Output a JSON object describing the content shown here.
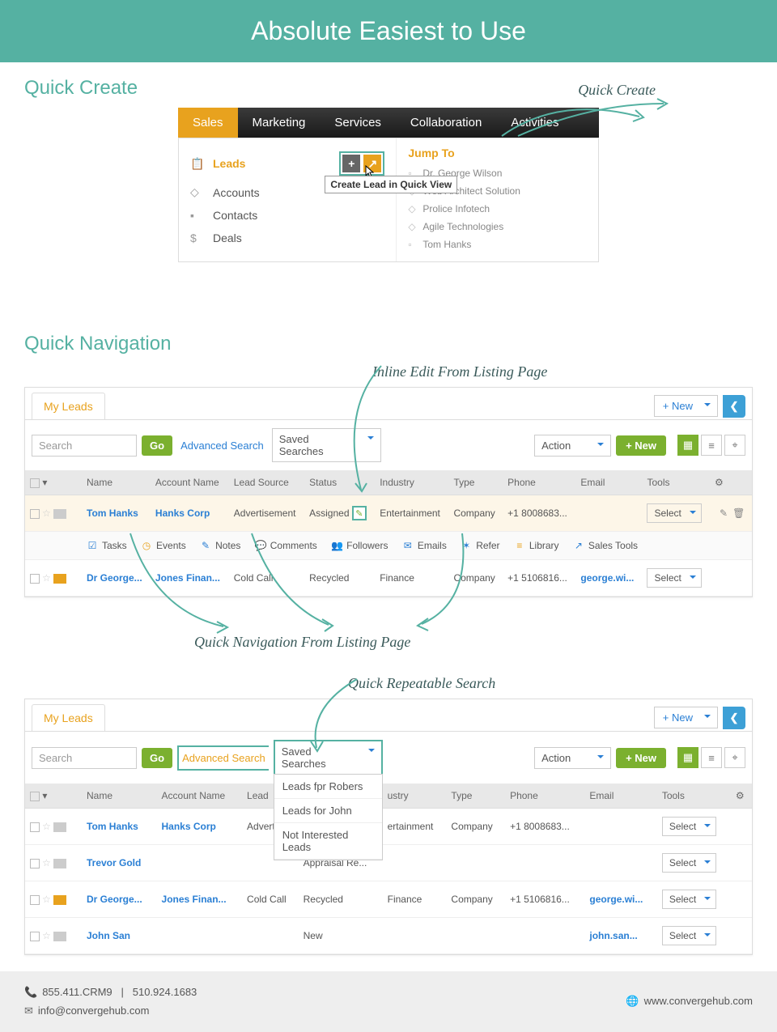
{
  "banner": {
    "title": "Absolute Easiest to Use"
  },
  "sections": {
    "quick_create": "Quick Create",
    "quick_navigation": "Quick Navigation"
  },
  "annotations": {
    "quick_create": "Quick Create",
    "inline_edit": "Inline Edit From Listing Page",
    "quick_nav": "Quick Navigation From Listing Page",
    "quick_search": "Quick Repeatable Search"
  },
  "nav": {
    "tabs": [
      "Sales",
      "Marketing",
      "Services",
      "Collaboration",
      "Activities"
    ],
    "active": "Sales",
    "menu": {
      "leads": "Leads",
      "accounts": "Accounts",
      "contacts": "Contacts",
      "deals": "Deals"
    },
    "tooltip": "Create Lead in Quick View",
    "jump_title": "Jump To",
    "jump": [
      "Dr. George Wilson",
      "Web Architect Solution",
      "Prolice Infotech",
      "Agile Technologies",
      "Tom Hanks"
    ]
  },
  "leads_panel": {
    "tab": "My Leads",
    "new_drop": "+ New",
    "search_ph": "Search",
    "go": "Go",
    "adv": "Advanced Search",
    "saved": "Saved Searches",
    "saved_items": [
      "Leads fpr Robers",
      "Leads for John",
      "Not Interested Leads"
    ],
    "action": "Action",
    "newbtn": "+ New",
    "select": "Select",
    "headers": {
      "name": "Name",
      "account": "Account Name",
      "source": "Lead Source",
      "status": "Status",
      "industry": "Industry",
      "type": "Type",
      "phone": "Phone",
      "email": "Email",
      "tools": "Tools"
    },
    "subtools": {
      "tasks": "Tasks",
      "events": "Events",
      "notes": "Notes",
      "comments": "Comments",
      "followers": "Followers",
      "emails": "Emails",
      "refer": "Refer",
      "library": "Library",
      "salestools": "Sales Tools"
    }
  },
  "rows1": [
    {
      "name": "Tom Hanks",
      "account": "Hanks Corp",
      "source": "Advertisement",
      "status": "Assigned",
      "industry": "Entertainment",
      "type": "Company",
      "phone": "+1 8008683...",
      "email": "",
      "flag": "g",
      "hl": true
    },
    {
      "name": "Dr George...",
      "account": "Jones Finan...",
      "source": "Cold Call",
      "status": "Recycled",
      "industry": "Finance",
      "type": "Company",
      "phone": "+1 5106816...",
      "email": "george.wi...",
      "flag": "o"
    }
  ],
  "rows2": [
    {
      "name": "Tom Hanks",
      "account": "Hanks Corp",
      "source": "Advert",
      "status": "",
      "industry": "ertainment",
      "type": "Company",
      "phone": "+1 8008683...",
      "email": "",
      "flag": "g"
    },
    {
      "name": "Trevor Gold",
      "account": "",
      "source": "",
      "status": "Appraisal Re...",
      "industry": "",
      "type": "",
      "phone": "",
      "email": "",
      "flag": "g"
    },
    {
      "name": "Dr George...",
      "account": "Jones Finan...",
      "source": "Cold Call",
      "status": "Recycled",
      "industry": "Finance",
      "type": "Company",
      "phone": "+1 5106816...",
      "email": "george.wi...",
      "flag": "o"
    },
    {
      "name": "John San",
      "account": "",
      "source": "",
      "status": "New",
      "industry": "",
      "type": "",
      "phone": "",
      "email": "john.san...",
      "flag": "g"
    }
  ],
  "footer": {
    "phone1": "855.411.CRM9",
    "divider": "|",
    "phone2": "510.924.1683",
    "email": "info@convergehub.com",
    "site": "www.convergehub.com"
  }
}
